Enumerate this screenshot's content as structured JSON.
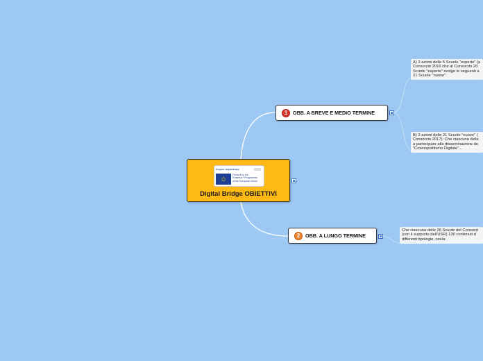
{
  "root": {
    "title": "Digital Bridge OBIETTIVI",
    "logo": {
      "project_label": "Progetto: Digital Bridge",
      "eu_text": "Funded by the\nErasmus+ Programme\nof the European Union"
    }
  },
  "topics": [
    {
      "number": "1",
      "label": "OBB. A BREVE E MEDIO TERMINE",
      "notes": [
        "A) 3 azioni delle 5 Scuole \"esperte\" (a\nConsorzio 2016 che al Consorzio 20\nScuole \"esperte\" svolge le seguenti a\n21 Scuole \"nuove\":",
        "B) 3 azioni delle 21 Scuole \"nuove\" (\nConsorzio 2017): Che ciascuna delle\na partecipare alla disseminazione de\n\"Cosmopolitismo Digitale\"..."
      ]
    },
    {
      "number": "2",
      "label": "OBB. A LUNGO TERMINE",
      "notes": [
        "Che ciascuna delle 26 Scuole del Consorzi\n(con il supporto dell'USR) 130 contenuti d\ndifferenti tipologie, ossia:"
      ]
    }
  ],
  "colors": {
    "background": "#9cc8f3",
    "root_fill": "#ffb914",
    "connector": "#ffffff",
    "topic1_badge": "#d9352b",
    "topic2_badge": "#f0852a"
  }
}
